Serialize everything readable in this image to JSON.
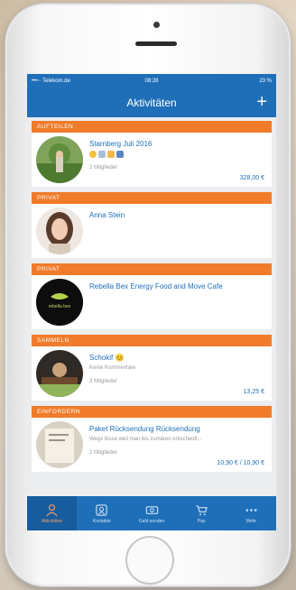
{
  "status_bar": {
    "carrier": "•••◦◦ Telekom.de",
    "time": "08:28",
    "battery": "23 %"
  },
  "nav": {
    "title": "Aktivitäten",
    "add_label": "+"
  },
  "sections": [
    {
      "header": "AUFTEILEN",
      "title": "Starnberg Juli 2016",
      "subtitle": "2 Mitglieder",
      "amount": "328,00 €",
      "avatar": "landscape"
    },
    {
      "header": "PRIVAT",
      "title": "Anna Stein",
      "subtitle": "",
      "amount": "",
      "avatar": "person"
    },
    {
      "header": "PRIVAT",
      "title": "Rebella Bex Energy Food and Move Cafe",
      "subtitle": "",
      "amount": "",
      "avatar": "logo",
      "logo_text": "rebella bex"
    },
    {
      "header": "SAMMELN",
      "title": "Schokif 😊",
      "subtitle2": "Keine Kommentare",
      "subtitle": "3 Mitglieder",
      "amount": "13,25 €",
      "avatar": "photo"
    },
    {
      "header": "EINFORDERN",
      "title": "Paket Rücksendung Rücksendung",
      "subtitle2": "Wegs bisse weil man bis zumären entscheidt...",
      "subtitle": "2 Mitglieder",
      "amount": "10,90 € / 10,90 €",
      "avatar": "paper"
    }
  ],
  "tabs": [
    {
      "label": "Aktivitäten",
      "icon": "person-icon",
      "active": true
    },
    {
      "label": "Kontakte",
      "icon": "contacts-icon",
      "active": false
    },
    {
      "label": "Geld senden",
      "icon": "money-icon",
      "active": false
    },
    {
      "label": "Pay",
      "icon": "cart-icon",
      "active": false
    },
    {
      "label": "Mehr",
      "icon": "more-icon",
      "active": false
    }
  ],
  "colors": {
    "brand_blue": "#1f6fb8",
    "accent_orange": "#f07b2a"
  }
}
